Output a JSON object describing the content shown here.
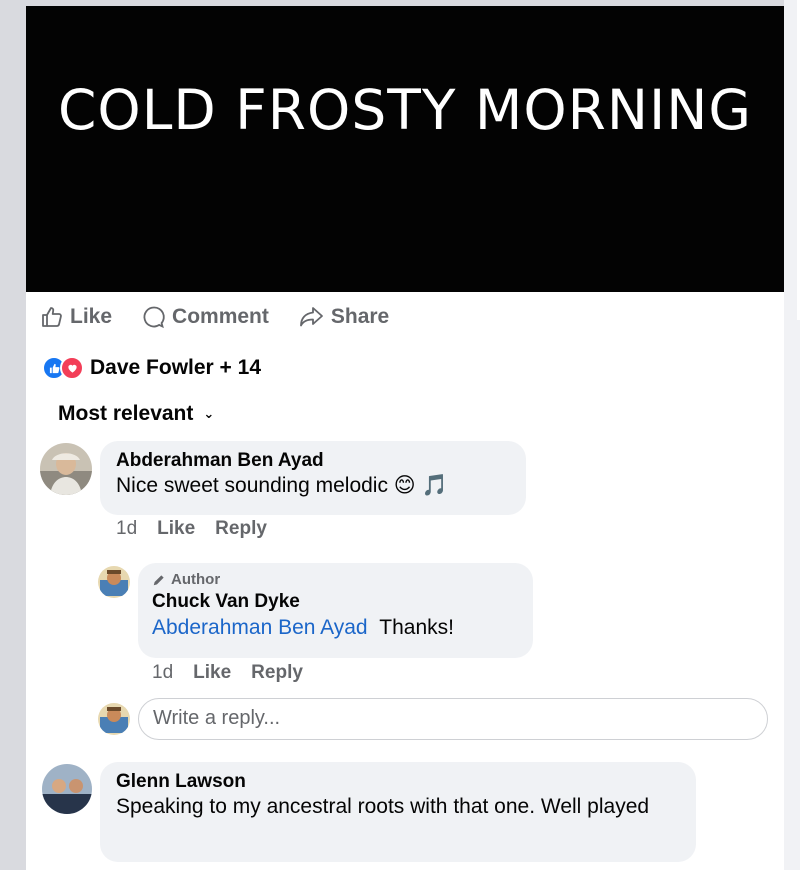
{
  "video": {
    "title": "COLD FROSTY MORNING"
  },
  "actions": {
    "like": "Like",
    "comment": "Comment",
    "share": "Share"
  },
  "reactions": {
    "text": "Dave Fowler + 14"
  },
  "sort": {
    "label": "Most relevant"
  },
  "comments": [
    {
      "name": "Abderahman Ben Ayad",
      "text": "Nice sweet sounding melodic 😊 🎵",
      "time": "1d",
      "like": "Like",
      "reply": "Reply"
    },
    {
      "badge": "Author",
      "name": "Chuck Van Dyke",
      "mention": "Abderahman Ben Ayad",
      "text": "Thanks!",
      "time": "1d",
      "like": "Like",
      "reply": "Reply"
    },
    {
      "name": "Glenn Lawson",
      "text": "Speaking to my ancestral roots with that one. Well played"
    }
  ],
  "reply_input": {
    "placeholder": "Write a reply..."
  },
  "colors": {
    "link": "#1b66c9",
    "muted": "#65676b",
    "bubble": "#f0f2f5",
    "like_blue": "#1877f2",
    "love_red": "#f33e58"
  }
}
